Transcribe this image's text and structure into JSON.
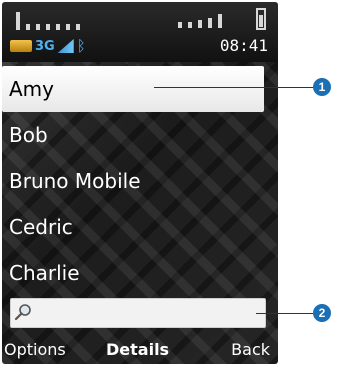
{
  "status": {
    "time": "08:41",
    "network_label": "3G",
    "icons": [
      "battery-icon",
      "network-3g-icon",
      "signal-strength-icon",
      "bluetooth-icon"
    ]
  },
  "contacts": [
    {
      "name": "Amy",
      "selected": true
    },
    {
      "name": "Bob",
      "selected": false
    },
    {
      "name": "Bruno Mobile",
      "selected": false
    },
    {
      "name": "Cedric",
      "selected": false
    },
    {
      "name": "Charlie",
      "selected": false
    }
  ],
  "search": {
    "value": ""
  },
  "softkeys": {
    "left": "Options",
    "center": "Details",
    "right": "Back"
  },
  "callouts": [
    "1",
    "2"
  ],
  "colors": {
    "selected_bg": "#ffffff",
    "callout": "#1b6fb5"
  }
}
